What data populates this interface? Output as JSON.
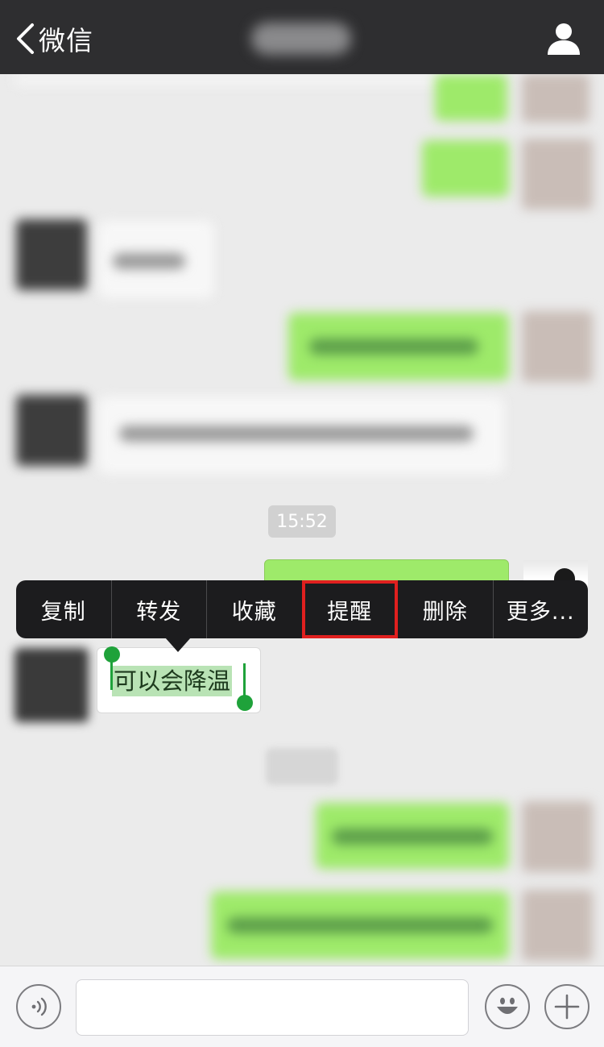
{
  "nav": {
    "back_label": "微信",
    "title_obscured": true
  },
  "chat": {
    "timestamp": "15:52",
    "selected_message_text": "可以会降温"
  },
  "context_menu": {
    "items": [
      {
        "label": "复制",
        "highlighted": false
      },
      {
        "label": "转发",
        "highlighted": false
      },
      {
        "label": "收藏",
        "highlighted": false
      },
      {
        "label": "提醒",
        "highlighted": true
      },
      {
        "label": "删除",
        "highlighted": false
      },
      {
        "label": "更多..."
      }
    ]
  },
  "toolbar": {
    "voice_icon": "voice-icon",
    "emoji_icon": "emoji-icon",
    "plus_icon": "plus-icon",
    "input_value": ""
  },
  "colors": {
    "nav_bg": "#2e2e30",
    "chat_bg": "#ebebeb",
    "sent_bubble": "#9eea6a",
    "menu_bg": "#1c1c1e",
    "highlight_border": "#e0201f",
    "selection": "#b9e3b5",
    "handle": "#1fa23a"
  }
}
